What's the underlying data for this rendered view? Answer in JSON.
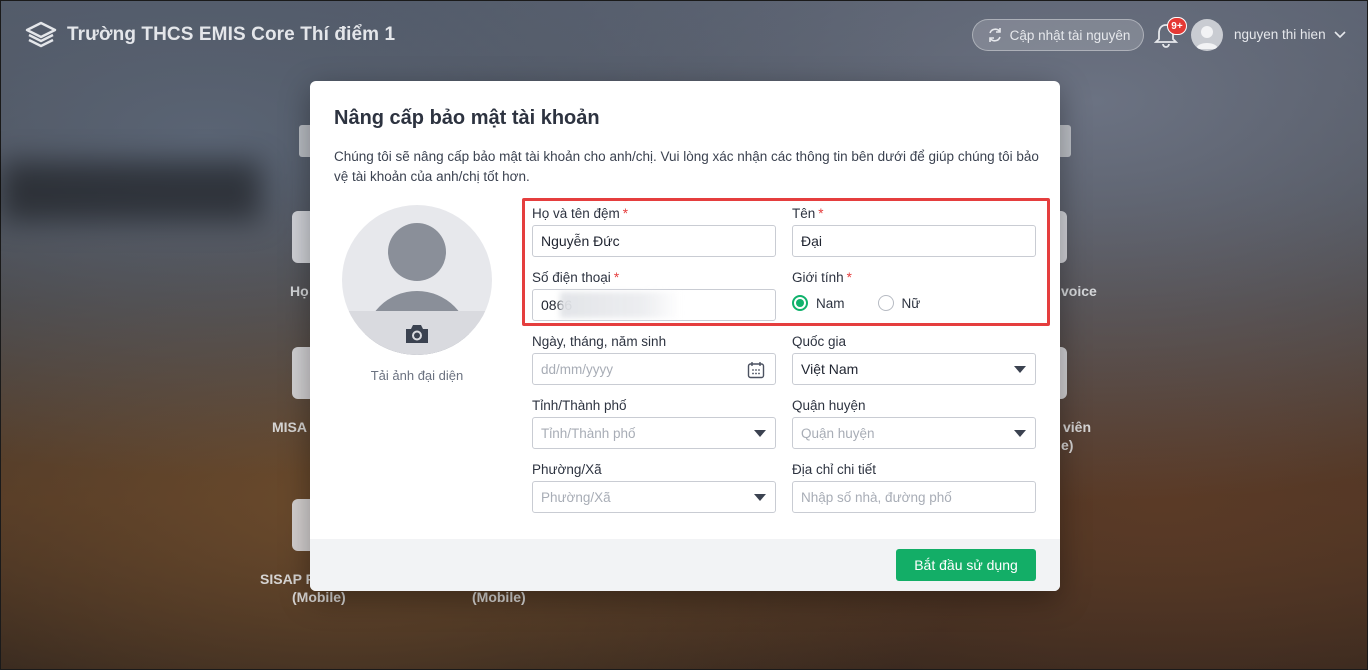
{
  "header": {
    "school_name": "Trường THCS EMIS Core Thí điểm 1",
    "update_button": "Cập nhật tài nguyên",
    "notification_badge": "9+",
    "user_name": "nguyen thi hien"
  },
  "background": {
    "labels": [
      "Họ",
      "voice",
      "MISA",
      "viên",
      "e)",
      "SISAP F",
      "(Mobile)",
      "(Mobile)"
    ]
  },
  "modal": {
    "title": "Nâng cấp bảo mật tài khoản",
    "description": "Chúng tôi sẽ nâng cấp bảo mật tài khoản cho anh/chị. Vui lòng xác nhận các thông tin bên dưới để giúp chúng tôi bảo vệ tài khoản của anh/chị tốt hơn.",
    "upload_avatar": "Tải ảnh đại diện",
    "fields": {
      "last_middle_name": {
        "label": "Họ và tên đệm",
        "value": "Nguyễn Đức",
        "required": "*"
      },
      "first_name": {
        "label": "Tên",
        "value": "Đại",
        "required": "*"
      },
      "phone": {
        "label": "Số điện thoại",
        "value": "0866",
        "required": "*"
      },
      "gender": {
        "label": "Giới tính",
        "required": "*",
        "options": [
          "Nam",
          "Nữ"
        ],
        "selected": "Nam"
      },
      "dob": {
        "label": "Ngày, tháng, năm sinh",
        "placeholder": "dd/mm/yyyy"
      },
      "country": {
        "label": "Quốc gia",
        "value": "Việt Nam"
      },
      "province": {
        "label": "Tỉnh/Thành phố",
        "placeholder": "Tỉnh/Thành phố"
      },
      "district": {
        "label": "Quận huyện",
        "placeholder": "Quận huyện"
      },
      "ward": {
        "label": "Phường/Xã",
        "placeholder": "Phường/Xã"
      },
      "address": {
        "label": "Địa chỉ chi tiết",
        "placeholder": "Nhập số nhà, đường phố"
      }
    },
    "submit_button": "Bắt đầu sử dụng"
  },
  "colors": {
    "accent_green": "#13ae67",
    "highlight_red": "#e53e3e",
    "required_red": "#e53e3e"
  }
}
